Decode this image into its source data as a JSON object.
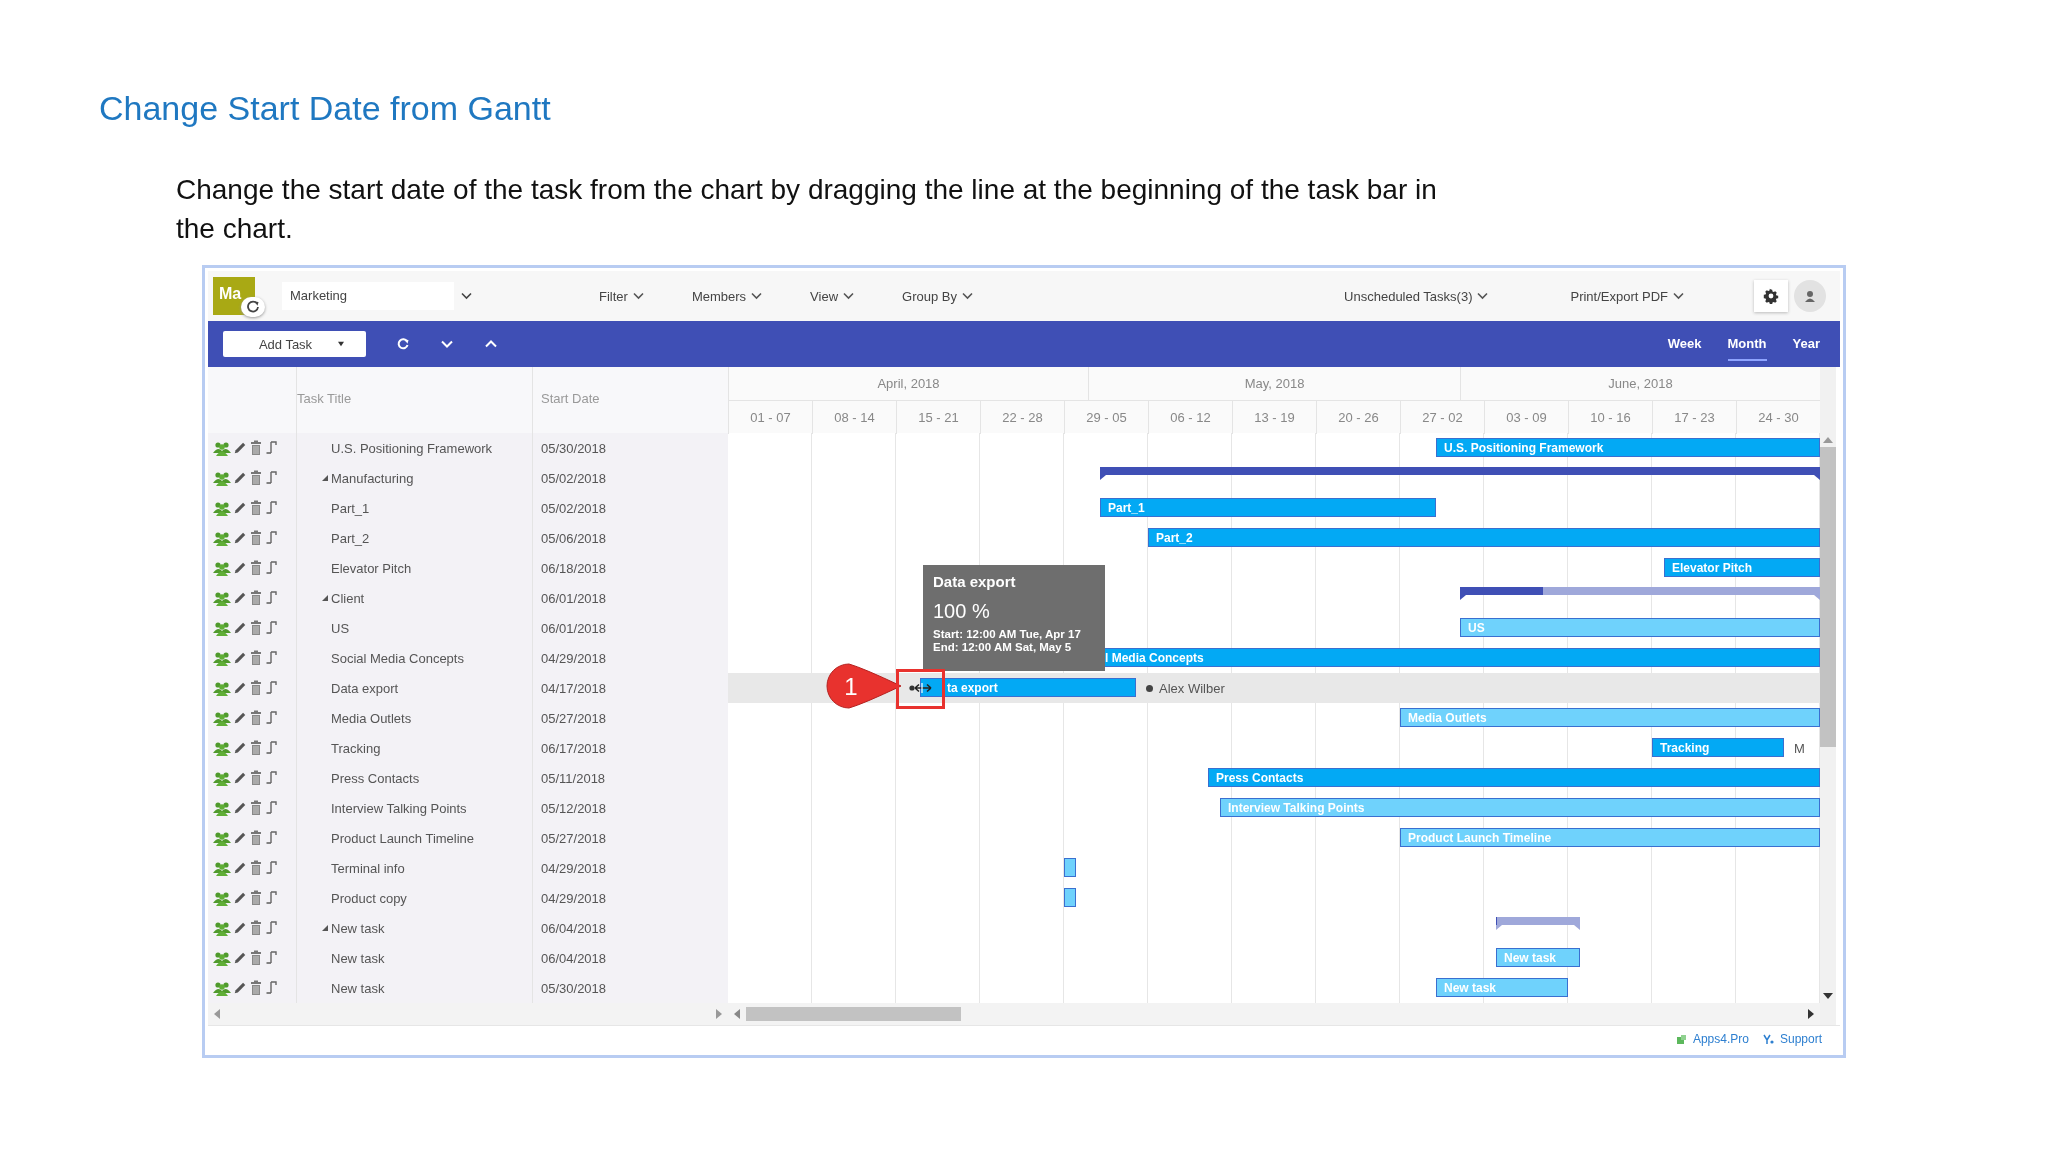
{
  "page_title": "Change Start Date from Gantt",
  "intro": "Change the start date of the task from the chart by dragging the line at the beginning of the task bar in the chart.",
  "app": {
    "logo": "Ma",
    "plan_selector": {
      "value": "Marketing"
    },
    "menus": [
      {
        "label": "Filter"
      },
      {
        "label": "Members"
      },
      {
        "label": "View"
      },
      {
        "label": "Group By"
      }
    ],
    "right_menus": [
      {
        "label": "Unscheduled Tasks(3)"
      },
      {
        "label": "Print/Export PDF"
      }
    ],
    "add_task_button": "Add Task",
    "views": [
      {
        "label": "Week",
        "selected": false
      },
      {
        "label": "Month",
        "selected": true
      },
      {
        "label": "Year",
        "selected": false
      }
    ],
    "columns": [
      "Task Title",
      "Start Date"
    ],
    "timeline": {
      "months": [
        "April, 2018",
        "May, 2018",
        "June, 2018"
      ],
      "weeks": [
        "01 - 07",
        "08 - 14",
        "15 - 21",
        "22 - 28",
        "29 - 05",
        "06 - 12",
        "13 - 19",
        "20 - 26",
        "27 - 02",
        "03 - 09",
        "10 - 16",
        "17 - 23",
        "24 - 30"
      ]
    },
    "tasks": [
      {
        "title": "U.S. Positioning Framework",
        "start_date": "05/30/2018",
        "selected": false,
        "bar": {
          "kind": "task",
          "label": "U.S. Positioning Framework",
          "color": "#03a9f4"
        }
      },
      {
        "title": "Manufacturing",
        "start_date": "05/02/2018",
        "selected": false,
        "expanded": true,
        "bar": {
          "kind": "summary",
          "level": 1
        },
        "children": [
          {
            "title": "Part_1",
            "start_date": "05/02/2018",
            "selected": false,
            "bar": {
              "kind": "task",
              "label": "Part_1",
              "color": "#03a9f4"
            }
          },
          {
            "title": "Part_2",
            "start_date": "05/06/2018",
            "selected": false,
            "bar": {
              "kind": "task",
              "label": "Part_2",
              "color": "#03a9f4"
            }
          }
        ]
      },
      {
        "title": "Elevator Pitch",
        "start_date": "06/18/2018",
        "selected": false,
        "bar": {
          "kind": "task",
          "label": "Elevator Pitch",
          "color": "#03a9f4"
        }
      },
      {
        "title": "Client",
        "start_date": "06/01/2018",
        "selected": false,
        "expanded": true,
        "bar": {
          "kind": "summary",
          "level": 0.23
        },
        "children": [
          {
            "title": "US",
            "start_date": "06/01/2018",
            "selected": false,
            "bar": {
              "kind": "task",
              "label": "US",
              "color": "#6fd2fc"
            }
          }
        ]
      },
      {
        "title": "Social Media Concepts",
        "start_date": "04/29/2018",
        "selected": false,
        "bar": {
          "kind": "task",
          "label": "l Media Concepts",
          "color": "#03a9f4",
          "label_covered": true
        }
      },
      {
        "title": "Data export",
        "start_date": "04/17/2018",
        "selected": true,
        "bar": {
          "kind": "task",
          "label": "ta export",
          "color": "#03a9f4",
          "dragging": true
        },
        "assignee": {
          "name": "Alex Wilber",
          "dot": true
        }
      },
      {
        "title": "Media Outlets",
        "start_date": "05/27/2018",
        "selected": false,
        "bar": {
          "kind": "task",
          "label": "Media Outlets",
          "color": "#6fd2fc"
        }
      },
      {
        "title": "Tracking",
        "start_date": "06/17/2018",
        "selected": false,
        "bar": {
          "kind": "task",
          "label": "Tracking",
          "color": "#03a9f4"
        },
        "assignee": {
          "name": "M",
          "dot": false
        }
      },
      {
        "title": "Press Contacts",
        "start_date": "05/11/2018",
        "selected": false,
        "bar": {
          "kind": "task",
          "label": "Press Contacts",
          "color": "#03a9f4"
        }
      },
      {
        "title": "Interview Talking Points",
        "start_date": "05/12/2018",
        "selected": false,
        "bar": {
          "kind": "task",
          "label": "Interview Talking Points",
          "color": "#6fd2fc"
        }
      },
      {
        "title": "Product Launch Timeline",
        "start_date": "05/27/2018",
        "selected": false,
        "bar": {
          "kind": "task",
          "label": "Product Launch Timeline",
          "color": "#6fd2fc"
        }
      },
      {
        "title": "Terminal info",
        "start_date": "04/29/2018",
        "selected": false,
        "bar": {
          "kind": "task",
          "color": "#6fd2fc"
        }
      },
      {
        "title": "Product copy",
        "start_date": "04/29/2018",
        "selected": false,
        "bar": {
          "kind": "task",
          "color": "#6fd2fc"
        }
      },
      {
        "title": "New task",
        "start_date": "06/04/2018",
        "selected": false,
        "expanded": true,
        "bar": {
          "kind": "summary",
          "level": 0
        },
        "children": [
          {
            "title": "New task",
            "start_date": "06/04/2018",
            "selected": false,
            "bar": {
              "kind": "task",
              "label": "New task",
              "color": "#6fd2fc"
            }
          }
        ]
      },
      {
        "title": "New task",
        "start_date": "05/30/2018",
        "selected": false,
        "bar": {
          "kind": "task",
          "label": "New task",
          "color": "#6fd2fc"
        }
      }
    ],
    "tooltip": {
      "title": "Data export",
      "progress": "100 %",
      "start": "Start: 12:00 AM Tue, Apr 17",
      "end": "End: 12:00 AM Sat, May 5"
    },
    "callout": {
      "number": "1"
    },
    "footer_links": [
      {
        "label": "Apps4.Pro"
      },
      {
        "label": "Support"
      }
    ]
  }
}
